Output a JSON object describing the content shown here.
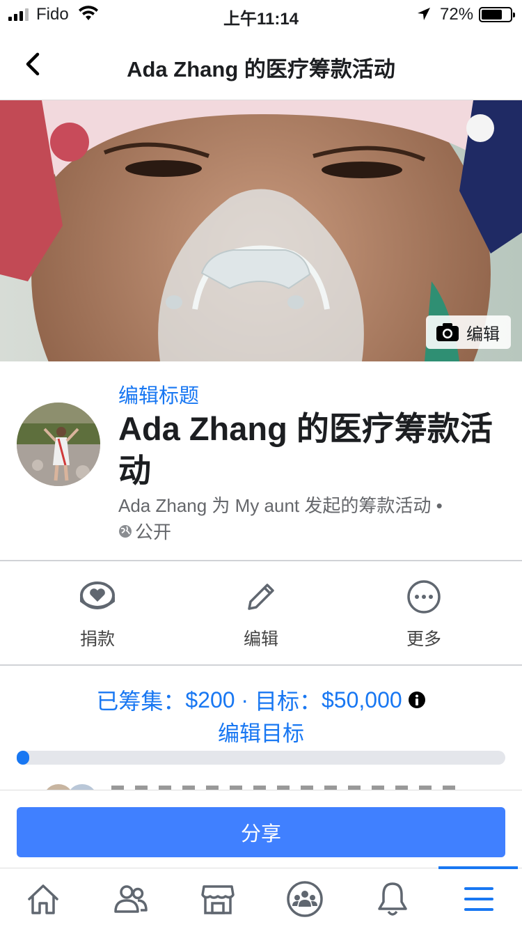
{
  "status_bar": {
    "carrier": "Fido",
    "time": "上午11:14",
    "battery_percent": "72%",
    "battery_level": 0.72
  },
  "header": {
    "title": "Ada Zhang 的医疗筹款活动"
  },
  "cover": {
    "edit_label": "编辑"
  },
  "fundraiser": {
    "edit_title_link": "编辑标题",
    "title": "Ada Zhang 的医疗筹款活动",
    "organizer_line": "Ada Zhang 为 My aunt 发起的筹款活动 •",
    "privacy": "公开"
  },
  "actions": {
    "donate": "捐款",
    "edit": "编辑",
    "more": "更多"
  },
  "progress": {
    "raised_label": "已筹集：",
    "raised_amount": "$200",
    "separator": " · ",
    "goal_label": "目标：",
    "goal_amount": "$50,000",
    "edit_goal_link": "编辑目标",
    "fraction": 0.004
  },
  "share_button": "分享",
  "colors": {
    "accent": "#1877f2",
    "share": "#4080ff"
  },
  "tab_bar": {
    "tabs": [
      "home-icon",
      "friends-icon",
      "marketplace-icon",
      "groups-icon",
      "notifications-icon",
      "menu-icon"
    ],
    "active": "menu-icon"
  }
}
